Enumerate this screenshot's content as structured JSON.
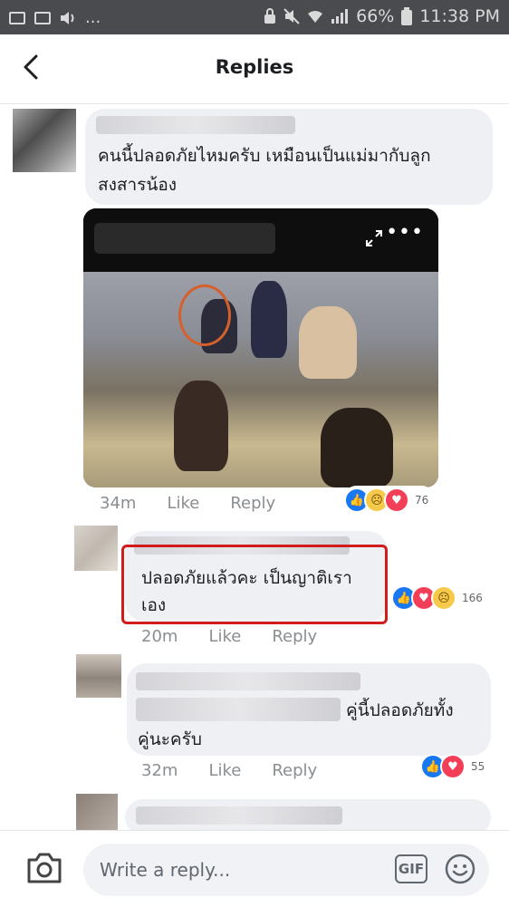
{
  "status_bar": {
    "battery_percent": "66%",
    "time": "11:38 PM",
    "overflow": "..."
  },
  "header": {
    "title": "Replies"
  },
  "comments": [
    {
      "text_line1": "คนนี้ปลอดภัยไหมครับ เหมือนเป็นแม่มากับลูก",
      "text_line2": "สงสารน้อง",
      "time": "34m",
      "like_label": "Like",
      "reply_label": "Reply",
      "reaction_count": "76",
      "reactions": [
        "like",
        "sad",
        "love"
      ]
    },
    {
      "text_line1": "ปลอดภัยแล้วคะ  เป็นญาติเรา",
      "text_line2": "เอง",
      "time": "20m",
      "like_label": "Like",
      "reply_label": "Reply",
      "reaction_count": "166",
      "reactions": [
        "like",
        "love",
        "sad"
      ]
    },
    {
      "text_line1": "คู่นี้ปลอดภัยทั้ง",
      "text_line2": "คู่นะครับ",
      "time": "32m",
      "like_label": "Like",
      "reply_label": "Reply",
      "reaction_count": "55",
      "reactions": [
        "like",
        "love"
      ]
    }
  ],
  "composer": {
    "placeholder": "Write a reply...",
    "gif_label": "GIF"
  },
  "colors": {
    "status_bar": "#4a4b4e",
    "bubble": "#eff0f3",
    "highlight_border": "#d11c1c",
    "like_blue": "#1877f2",
    "love_red": "#f33e58"
  },
  "icons": [
    "back-arrow-icon",
    "expand-icon",
    "more-icon",
    "camera-icon",
    "gif-icon",
    "smiley-icon"
  ]
}
